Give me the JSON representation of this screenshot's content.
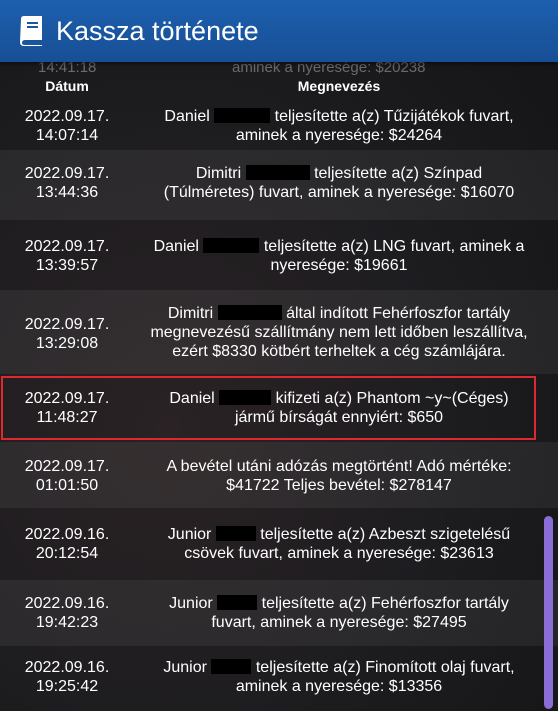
{
  "window": {
    "title": "Kassza története"
  },
  "table": {
    "headers": {
      "date": "Dátum",
      "description": "Megnevezés"
    },
    "partial_top": {
      "time": "14:41:18",
      "text": "aminek a nyeresége: $20238"
    },
    "rows": [
      {
        "date": "2022.09.17.",
        "time": "14:07:14",
        "name": "Daniel",
        "l1": "teljesítette a(z) Tűzijátékok fuvart,",
        "l2": "aminek a nyeresége: $24264",
        "l3": ""
      },
      {
        "date": "2022.09.17.",
        "time": "13:44:36",
        "name": "Dimitri",
        "l1": "teljesítette a(z) Színpad",
        "l2": "(Túlméretes) fuvart, aminek a nyeresége: $16070",
        "l3": ""
      },
      {
        "date": "2022.09.17.",
        "time": "13:39:57",
        "name": "Daniel",
        "l1": "teljesítette a(z) LNG fuvart, aminek a",
        "l2": "nyeresége: $19661",
        "l3": ""
      },
      {
        "date": "2022.09.17.",
        "time": "13:29:08",
        "name": "Dimitri",
        "l1": "által indított Fehérfoszfor tartály",
        "l2": "megnevezésű szállítmány nem lett időben leszállítva,",
        "l3": "ezért $8330 kötbért terheltek a cég számlájára."
      },
      {
        "date": "2022.09.17.",
        "time": "11:48:27",
        "name": "Daniel",
        "l1": "kifizeti a(z) Phantom ~y~(Céges)",
        "l2": "jármű bírságát ennyiért: $650",
        "l3": ""
      },
      {
        "date": "2022.09.17.",
        "time": "01:01:50",
        "name": "",
        "l1": "A bevétel utáni adózás megtörtént! Adó mértéke:",
        "l2": "$41722 Teljes bevétel: $278147",
        "l3": ""
      },
      {
        "date": "2022.09.16.",
        "time": "20:12:54",
        "name": "Junior",
        "l1": "teljesítette a(z) Azbeszt szigetelésű",
        "l2": "csövek fuvart, aminek a nyeresége: $23613",
        "l3": ""
      },
      {
        "date": "2022.09.16.",
        "time": "19:42:23",
        "name": "Junior",
        "l1": "teljesítette a(z) Fehérfoszfor tartály",
        "l2": "fuvart, aminek a nyeresége: $27495",
        "l3": ""
      },
      {
        "date": "2022.09.16.",
        "time": "19:25:42",
        "name": "Junior",
        "l1": "teljesítette a(z) Finomított olaj fuvart,",
        "l2": "aminek a nyeresége: $13356",
        "l3": ""
      }
    ]
  },
  "icons": {
    "title_icon": "book-icon"
  },
  "colors": {
    "titlebar": "#1a56a0",
    "highlight": "#e0282e",
    "scrollbar": "#8b6dd6"
  }
}
